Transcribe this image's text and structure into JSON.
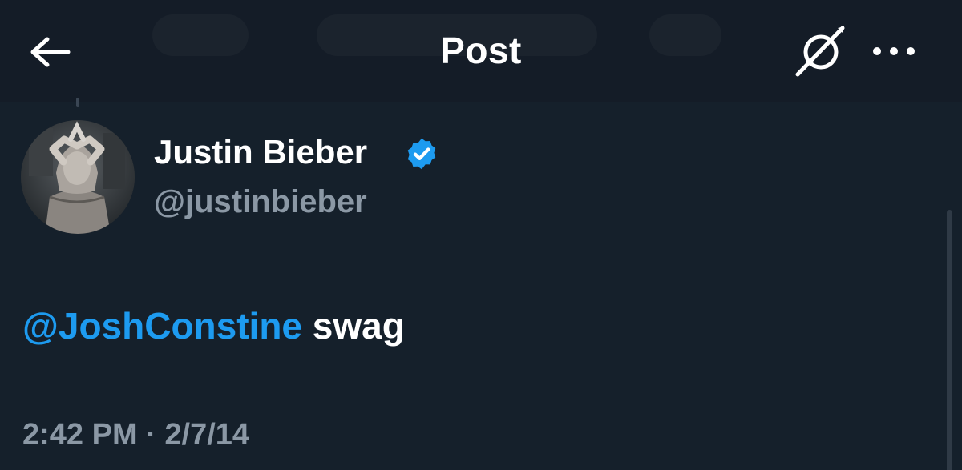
{
  "header": {
    "title": "Post",
    "back_icon": "arrow-left-icon",
    "grok_icon": "grok-slash-icon",
    "more_icon": "more-horizontal-icon"
  },
  "post": {
    "author": {
      "name": "Justin Bieber",
      "handle": "@justinbieber",
      "verified_icon": "verified-badge-icon"
    },
    "text": {
      "mention": "@JoshConstine",
      "body": " swag"
    },
    "timestamp": {
      "time": "2:42 PM",
      "separator": " · ",
      "date": "2/7/14"
    }
  },
  "colors": {
    "background": "#15202b",
    "accent": "#1d9bf0",
    "secondary_text": "#8b98a5",
    "primary_text": "#ffffff"
  }
}
